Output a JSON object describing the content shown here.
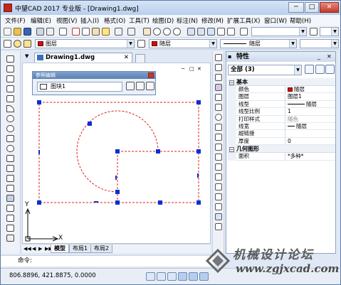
{
  "window": {
    "title": "中望CAD 2017 专业版 - [Drawing1.dwg]",
    "controls": [
      "─",
      "□",
      "✕"
    ]
  },
  "menubar": {
    "items": [
      "文件(F)",
      "编辑(E)",
      "视图(V)",
      "插入(I)",
      "格式(O)",
      "工具(T)",
      "绘图(D)",
      "标注(N)",
      "修改(M)",
      "扩展工具(X)",
      "窗口(W)",
      "帮助(H)"
    ]
  },
  "toolbar2": {
    "layer_combo": "图层",
    "color_combo": "随层",
    "linetype_combo": "随层"
  },
  "document": {
    "tab_label": "Drawing1.dwg",
    "tab_close": "✕",
    "canvas_controls": [
      "─",
      "□",
      "✕"
    ]
  },
  "ref_edit": {
    "title": "参照编辑",
    "block_value": "图块1"
  },
  "ucs": {
    "x_label": "X",
    "y_label": "Y"
  },
  "layout_tabs": {
    "nav": [
      "◀◀",
      "◀",
      "▶",
      "▶▶"
    ],
    "tabs": [
      "模型",
      "布局1",
      "布局2"
    ],
    "active": "模型"
  },
  "command": {
    "prompt": "命令:"
  },
  "properties": {
    "title": "特性",
    "pin": "▪",
    "controls": [
      "_",
      "✕"
    ],
    "selection": "全部 (3)",
    "sections": [
      {
        "name": "基本",
        "rows": [
          {
            "key": "颜色",
            "value": "随层",
            "swatch": "#d01010"
          },
          {
            "key": "图层",
            "value": "图层1"
          },
          {
            "key": "线型",
            "value": "随层",
            "line": true
          },
          {
            "key": "线型比例",
            "value": "1"
          },
          {
            "key": "打印样式",
            "value": "随色"
          },
          {
            "key": "线宽",
            "value": "随层",
            "line_short": true
          },
          {
            "key": "超链接",
            "value": ""
          },
          {
            "key": "厚度",
            "value": "0"
          }
        ]
      },
      {
        "name": "几何图形",
        "rows": [
          {
            "key": "面积",
            "value": "*多种*"
          }
        ]
      }
    ]
  },
  "status": {
    "coords": "806.8896, 421.8875, 0.0000"
  },
  "watermark": {
    "title": "机械设计论坛",
    "url": "www.zgjxcad.com"
  },
  "colors": {
    "selected_layer_red": "#d01010",
    "grip_blue": "#0a2fd6",
    "geometry_red": "#e02020"
  }
}
